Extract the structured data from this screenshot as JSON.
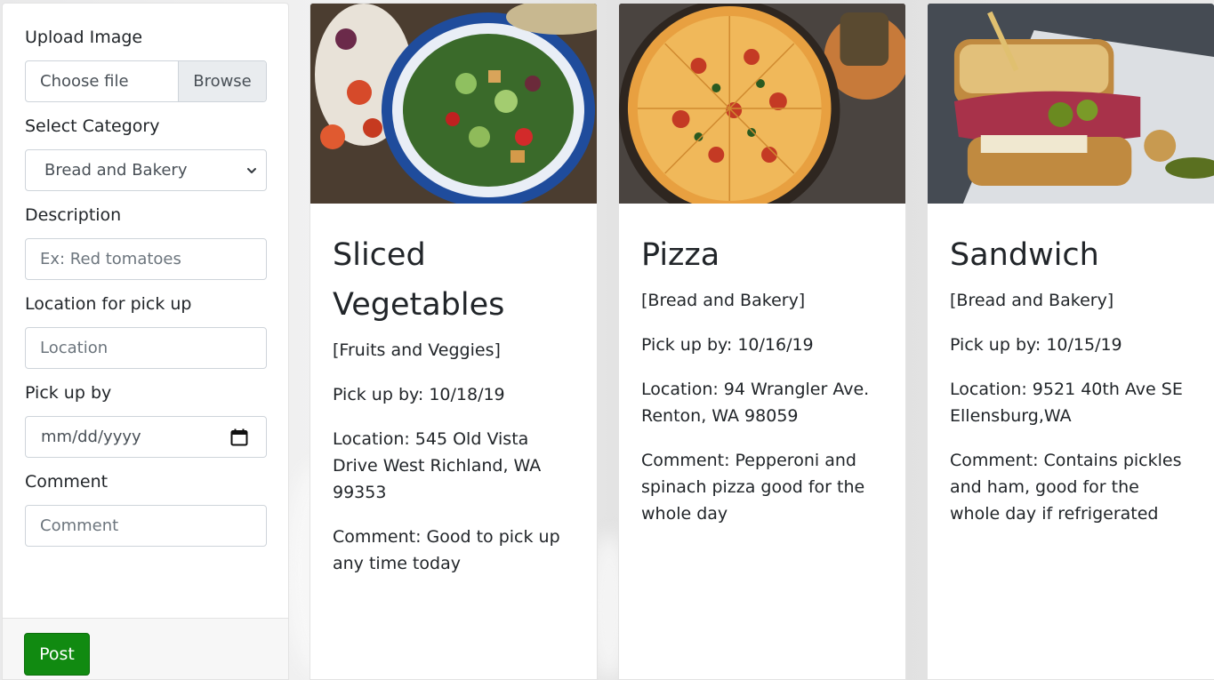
{
  "form": {
    "upload_label": "Upload Image",
    "file_placeholder": "Choose file",
    "browse_label": "Browse",
    "category_label": "Select Category",
    "category_selected": "Bread and Bakery",
    "description_label": "Description",
    "description_placeholder": "Ex: Red tomatoes",
    "location_label": "Location for pick up",
    "location_placeholder": "Location",
    "pickup_label": "Pick up by",
    "pickup_placeholder": "mm/dd/yyyy",
    "comment_label": "Comment",
    "comment_placeholder": "Comment",
    "post_label": "Post"
  },
  "cards": [
    {
      "title": "Sliced Vegetables",
      "category": "[Fruits and Veggies]",
      "pickup": "Pick up by: 10/18/19",
      "location": "Location: 545 Old Vista Drive West Richland, WA 99353",
      "comment": "Comment: Good to pick up any time today",
      "image": "salad-bowl-photo"
    },
    {
      "title": "Pizza",
      "category": "[Bread and Bakery]",
      "pickup": "Pick up by: 10/16/19",
      "location": "Location: 94 Wrangler Ave. Renton, WA 98059",
      "comment": "Comment: Pepperoni and spinach pizza good for the whole day",
      "image": "pizza-photo"
    },
    {
      "title": "Sandwich",
      "category": "[Bread and Bakery]",
      "pickup": "Pick up by: 10/15/19",
      "location": "Location: 9521 40th Ave SE Ellensburg,WA",
      "comment": "Comment: Contains pickles and ham, good for the whole day if refrigerated",
      "image": "sandwich-photo"
    }
  ],
  "colors": {
    "post_button": "#118a11",
    "input_border": "#ced4da"
  }
}
